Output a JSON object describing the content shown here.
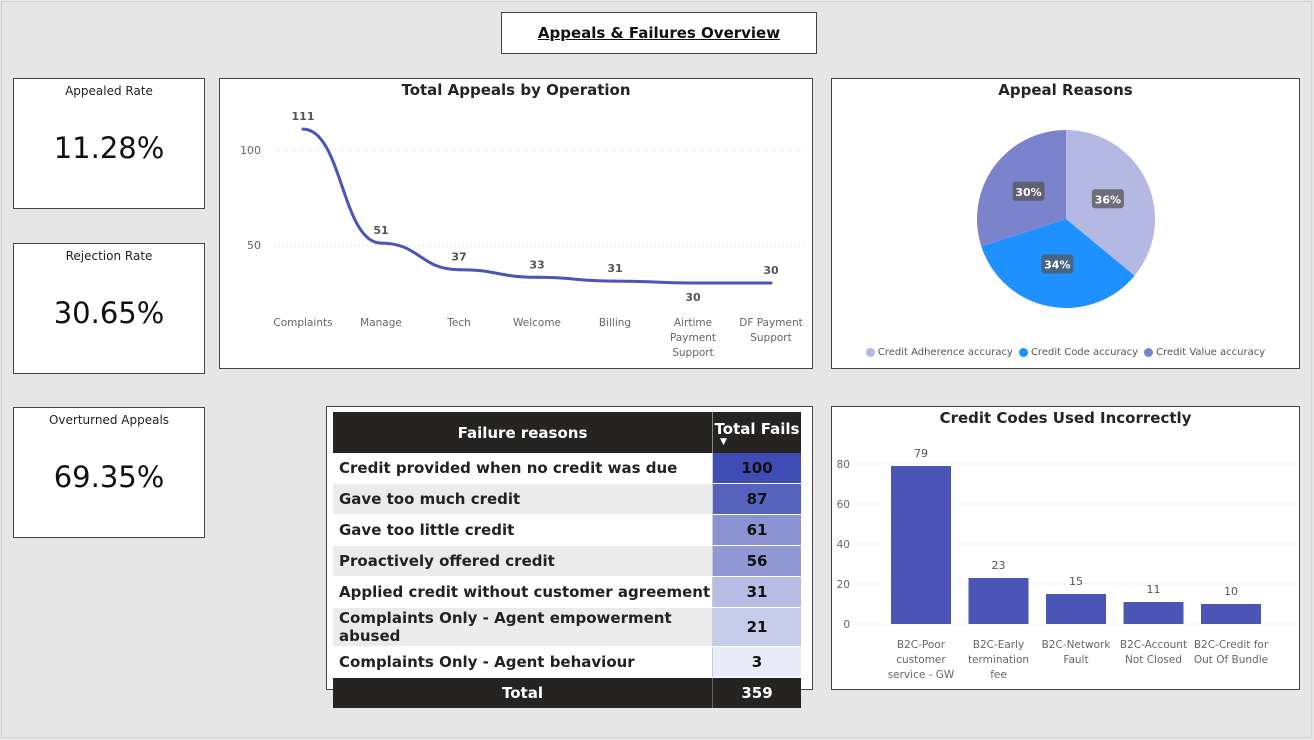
{
  "page": {
    "title": "Appeals & Failures Overview"
  },
  "kpis": {
    "appealed": {
      "label": "Appealed Rate",
      "value": "11.28%"
    },
    "rejection": {
      "label": "Rejection Rate",
      "value": "30.65%"
    },
    "overturned": {
      "label": "Overturned Appeals",
      "value": "69.35%"
    }
  },
  "chart_data": [
    {
      "type": "line",
      "title": "Total Appeals by Operation",
      "categories": [
        [
          "Complaints"
        ],
        [
          "Manage"
        ],
        [
          "Tech"
        ],
        [
          "Welcome"
        ],
        [
          "Billing"
        ],
        [
          "Airtime",
          "Payment",
          "Support"
        ],
        [
          "DF Payment",
          "Support"
        ]
      ],
      "values": [
        111,
        51,
        37,
        33,
        31,
        30,
        30
      ],
      "labels": [
        "111",
        "51",
        "37",
        "33",
        "31",
        "30",
        "30"
      ],
      "yticks": [
        "50",
        "100"
      ],
      "ylim": [
        0,
        125
      ],
      "color": "#4a55b5",
      "grid": true
    },
    {
      "type": "pie",
      "title": "Appeal Reasons",
      "slices": [
        {
          "name": "Credit Adherence accuracy",
          "value": 36,
          "label": "36%",
          "color": "#b4b9e3"
        },
        {
          "name": "Credit Code accuracy",
          "value": 34,
          "label": "34%",
          "color": "#1e90ff"
        },
        {
          "name": "Credit Value accuracy",
          "value": 30,
          "label": "30%",
          "color": "#7b83cc"
        }
      ],
      "legend": "bottom-center"
    },
    {
      "type": "bar",
      "title": "Credit Codes Used Incorrectly",
      "categories": [
        [
          "B2C-Poor",
          "customer",
          "service - GW"
        ],
        [
          "B2C-Early",
          "termination",
          "fee"
        ],
        [
          "B2C-Network",
          "Fault"
        ],
        [
          "B2C-Account",
          "Not Closed"
        ],
        [
          "B2C-Credit for",
          "Out Of Bundle"
        ]
      ],
      "values": [
        79,
        23,
        15,
        11,
        10
      ],
      "labels": [
        "79",
        "23",
        "15",
        "11",
        "10"
      ],
      "yticks": [
        "0",
        "20",
        "40",
        "60",
        "80"
      ],
      "ylim": [
        0,
        85
      ],
      "color": "#4a55b5",
      "grid": true
    },
    {
      "type": "table",
      "headers": [
        "Failure reasons",
        "Total Fails"
      ],
      "rows": [
        {
          "reason": "Credit provided when no credit was due",
          "value": "100",
          "bg": "#3f4cb3",
          "fg": "#111"
        },
        {
          "reason": "Gave too much credit",
          "value": "87",
          "bg": "#5563bd",
          "fg": "#111"
        },
        {
          "reason": "Gave too little credit",
          "value": "61",
          "bg": "#8b93d2",
          "fg": "#111"
        },
        {
          "reason": "Proactively offered credit",
          "value": "56",
          "bg": "#9199d5",
          "fg": "#111"
        },
        {
          "reason": "Applied credit without customer agreement",
          "value": "31",
          "bg": "#b7bce4",
          "fg": "#111"
        },
        {
          "reason": "Complaints Only - Agent empowerment abused",
          "value": "21",
          "bg": "#c8cceb",
          "fg": "#111"
        },
        {
          "reason": "Complaints Only - Agent behaviour",
          "value": "3",
          "bg": "#e9ebf8",
          "fg": "#111"
        }
      ],
      "total": {
        "label": "Total",
        "value": "359"
      }
    }
  ]
}
